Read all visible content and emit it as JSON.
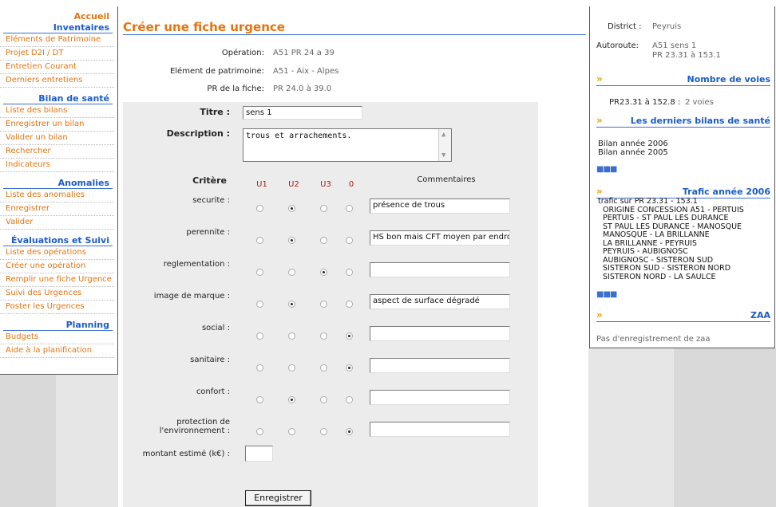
{
  "nav": {
    "sections": [
      {
        "title": "Accueil",
        "style": "orange",
        "items": []
      },
      {
        "title": "Inventaires",
        "items": [
          "Eléments de Patrimoine",
          "Projet D2I / DT",
          "Entretien Courant",
          "Derniers entretiens"
        ]
      },
      {
        "title": "Bilan de santé",
        "items": [
          "Liste des bilans",
          "Enregistrer un bilan",
          "Valider un bilan",
          "Rechercher",
          "Indicateurs"
        ]
      },
      {
        "title": "Anomalies",
        "items": [
          "Liste des anomalies",
          "Enregistrer",
          "Valider"
        ]
      },
      {
        "title": "Évaluations et Suivi",
        "items": [
          "Liste des opérations",
          "Créer une opération",
          "Remplir une fiche Urgence",
          "Suivi des Urgences",
          "Poster les Urgences"
        ]
      },
      {
        "title": "Planning",
        "items": [
          "Budgets",
          "Aide à la planification"
        ]
      }
    ]
  },
  "main": {
    "title": "Créer une fiche urgence",
    "info": [
      {
        "label": "Opération:",
        "value": "A51 PR 24 a 39"
      },
      {
        "label": "Elément de patrimoine:",
        "value": "A51 - Aix - Alpes"
      },
      {
        "label": "PR de la fiche:",
        "value": "PR 24.0 à 39.0"
      }
    ],
    "form": {
      "titre_label": "Titre :",
      "titre_value": "sens 1",
      "description_label": "Description :",
      "description_value": "trous et arrachements.",
      "critere_header": "Critère",
      "columns": [
        "U1",
        "U2",
        "U3",
        "0"
      ],
      "comment_header": "Commentaires",
      "criteria": [
        {
          "label": "securite :",
          "selected": 1,
          "comment": "présence de trous"
        },
        {
          "label": "perennite :",
          "selected": 1,
          "comment": "HS bon mais CFT moyen par endroits"
        },
        {
          "label": "reglementation :",
          "selected": 2,
          "comment": ""
        },
        {
          "label": "image de marque :",
          "selected": 1,
          "comment": "aspect de surface dégradé"
        },
        {
          "label": "social :",
          "selected": 3,
          "comment": ""
        },
        {
          "label": "sanitaire :",
          "selected": 3,
          "comment": ""
        },
        {
          "label": "confort :",
          "selected": 1,
          "comment": ""
        },
        {
          "label": "protection de l'environnement :",
          "selected": 3,
          "comment": ""
        }
      ],
      "montant_label": "montant estimé (k€) :",
      "montant_value": "",
      "submit_label": "Enregistrer"
    }
  },
  "right": {
    "district_label": "District :",
    "district_value": "Peyruis",
    "autoroute_label": "Autoroute:",
    "autoroute_value1": "A51 sens 1",
    "autoroute_value2": "PR 23.31 à 153.1",
    "voies_title": "Nombre de voies",
    "voies_range": "PR23.31 à 152.8 :",
    "voies_value": "2 voies",
    "bilans_title": "Les derniers bilans de santé",
    "bilans": [
      "Bilan année 2006",
      "Bilan année 2005"
    ],
    "trafic_title": "Trafic année 2006",
    "trafic_lines": [
      "trafic sur PR 23.31 - 153.1",
      "ORIGINE CONCESSION A51 - PERTUIS",
      "PERTUIS - ST PAUL LES DURANCE",
      "ST PAUL LES DURANCE - MANOSQUE",
      "MANOSQUE - LA BRILLANNE",
      "LA BRILLANNE - PEYRUIS",
      "PEYRUIS - AUBIGNOSC",
      "AUBIGNOSC - SISTERON SUD",
      "SISTERON SUD - SISTERON NORD",
      "SISTERON NORD - LA SAULCE"
    ],
    "zaa_title": "ZAA",
    "zaa_text": "Pas d'enregistrement de zaa",
    "arrow_glyph": "»",
    "more_glyph": "■■■"
  },
  "colors": {
    "accent_orange": "#e8730e",
    "link_blue": "#1a5cc8",
    "header_red": "#b01818"
  }
}
